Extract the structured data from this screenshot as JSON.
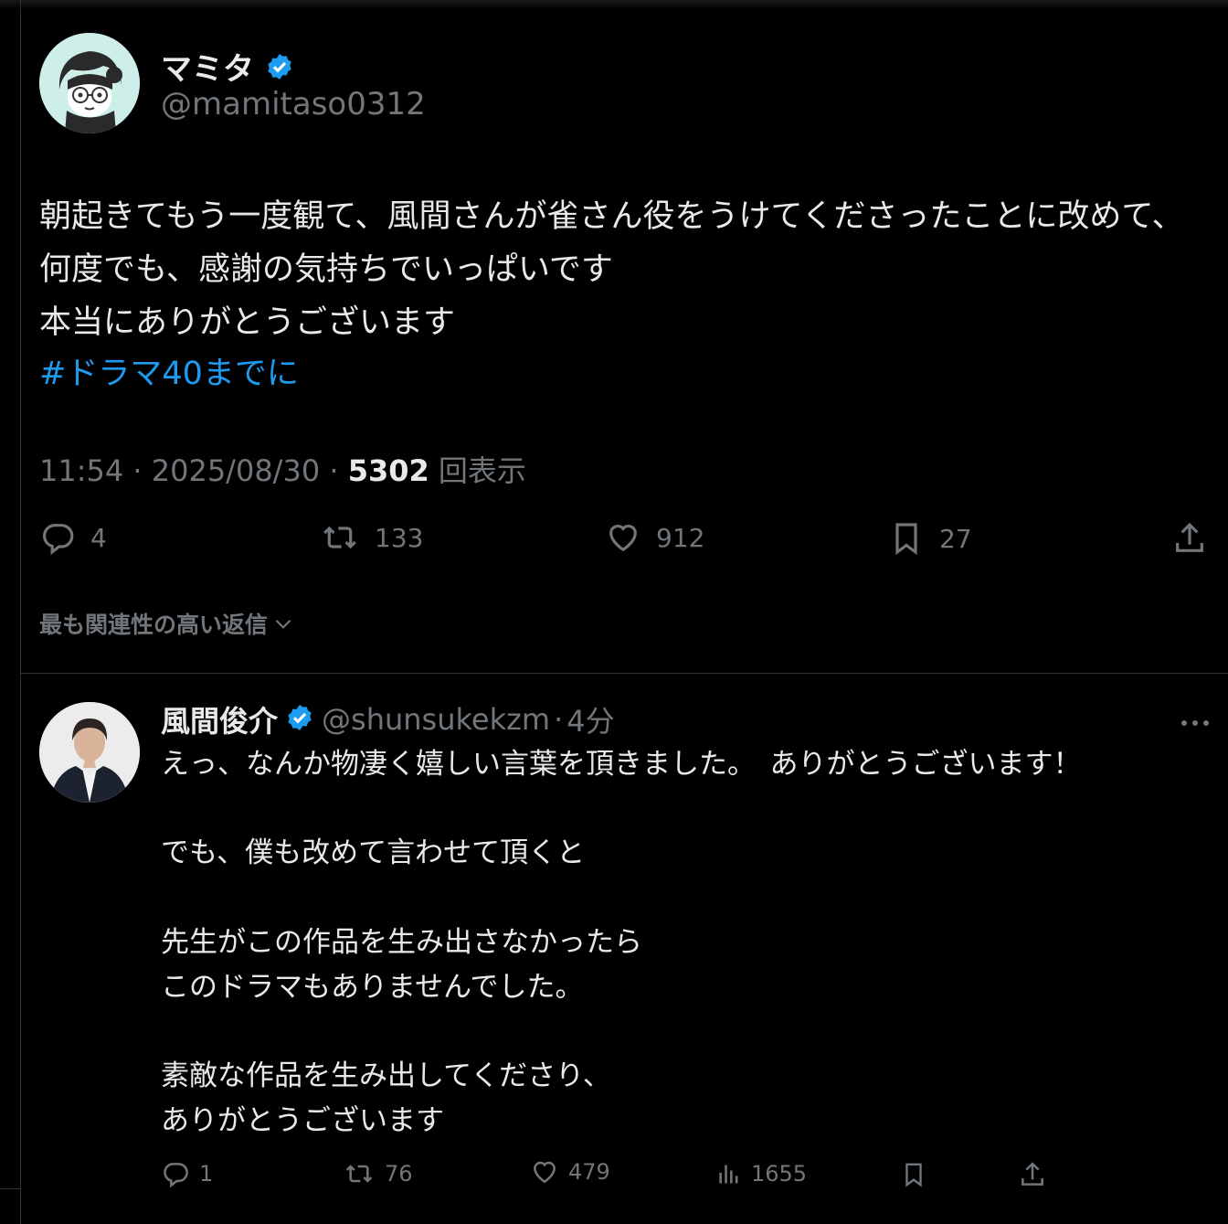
{
  "tweet": {
    "name": "マミタ",
    "handle": "@mamitaso0312",
    "text": "朝起きてもう一度観て、風間さんが雀さん役をうけてくださったことに改めて、何度でも、感謝の気持ちでいっぱいです\n本当にありがとうございます",
    "hashtag": "#ドラマ40までに",
    "time": "11:54",
    "date": "2025/08/30",
    "views": "5302",
    "views_label": "回表示",
    "replies": "4",
    "retweets": "133",
    "likes": "912",
    "bookmarks": "27"
  },
  "sort_label": "最も関連性の高い返信",
  "reply": {
    "name": "風間俊介",
    "handle": "@shunsukekzm",
    "time": "4分",
    "text": "えっ、なんか物凄く嬉しい言葉を頂きました。　ありがとうございます！\n\nでも、僕も改めて言わせて頂くと\n\n先生がこの作品を生み出さなかったら\nこのドラマもありませんでした。\n\n素敵な作品を生み出してくださり、\nありがとうございます",
    "replies": "1",
    "retweets": "76",
    "likes": "479",
    "views": "1655"
  },
  "colors": {
    "accent": "#1d9bf0",
    "muted": "#71767b",
    "text": "#e7e9ea",
    "background": "#000000"
  },
  "icons": [
    "verified-badge-icon",
    "reply-icon",
    "retweet-icon",
    "like-icon",
    "bookmark-icon",
    "share-icon",
    "chevron-down-icon",
    "more-icon",
    "views-icon"
  ]
}
